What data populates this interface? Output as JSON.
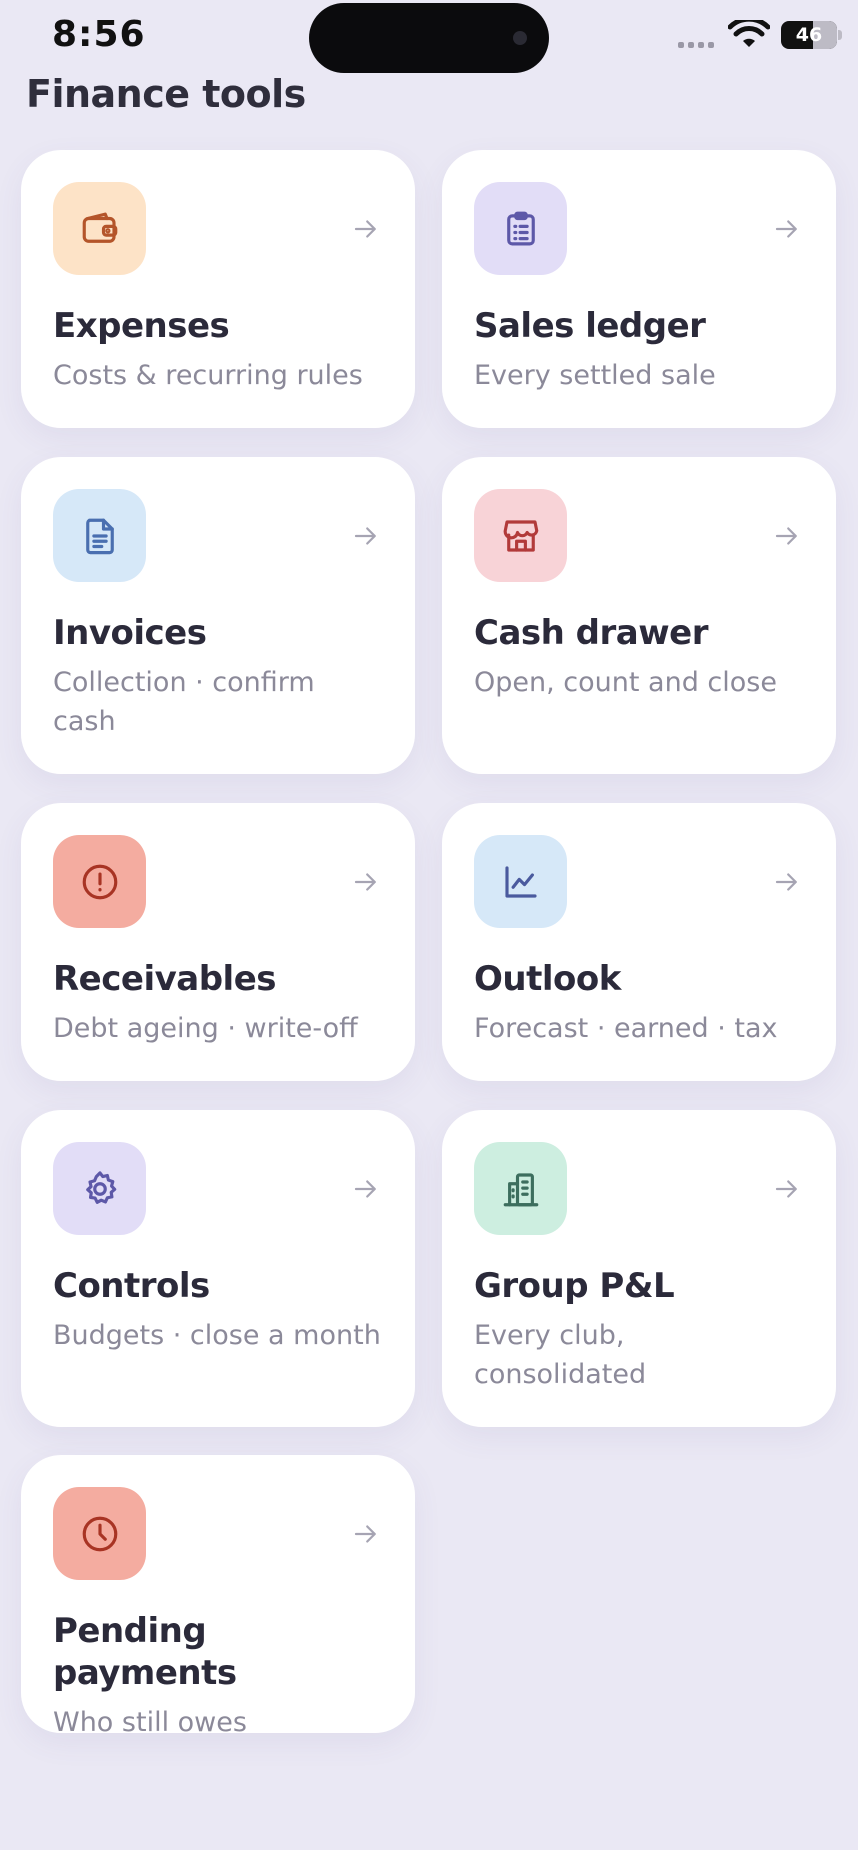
{
  "status": {
    "time": "8:56",
    "battery": "46"
  },
  "page": {
    "title": "Finance tools"
  },
  "tools": [
    {
      "title": "Expenses",
      "subtitle": "Costs & recurring rules",
      "icon": "wallet-icon",
      "tile_color": "#fde3c7",
      "icon_color": "#b4552a"
    },
    {
      "title": "Sales ledger",
      "subtitle": "Every settled sale",
      "icon": "clipboard-list-icon",
      "tile_color": "#e2ddf7",
      "icon_color": "#5d58a8"
    },
    {
      "title": "Invoices",
      "subtitle": "Collection · confirm cash",
      "icon": "document-icon",
      "tile_color": "#d6e8f8",
      "icon_color": "#4a6fb0"
    },
    {
      "title": "Cash drawer",
      "subtitle": "Open, count and close",
      "icon": "store-icon",
      "tile_color": "#f8d3d7",
      "icon_color": "#b23a3a"
    },
    {
      "title": "Receivables",
      "subtitle": "Debt ageing · write-off",
      "icon": "alert-circle-icon",
      "tile_color": "#f4aca0",
      "icon_color": "#a83424"
    },
    {
      "title": "Outlook",
      "subtitle": "Forecast · earned · tax",
      "icon": "line-chart-icon",
      "tile_color": "#d6e8f8",
      "icon_color": "#4a5a9e"
    },
    {
      "title": "Controls",
      "subtitle": "Budgets · close a month",
      "icon": "gear-icon",
      "tile_color": "#e2ddf7",
      "icon_color": "#5d58a8"
    },
    {
      "title": "Group P&L",
      "subtitle": "Every club, consolidated",
      "icon": "building-icon",
      "tile_color": "#cdeee0",
      "icon_color": "#3c6e5e"
    },
    {
      "title": "Pending payments",
      "subtitle": "Who still owes",
      "icon": "clock-icon",
      "tile_color": "#f4aca0",
      "icon_color": "#a83424"
    }
  ]
}
